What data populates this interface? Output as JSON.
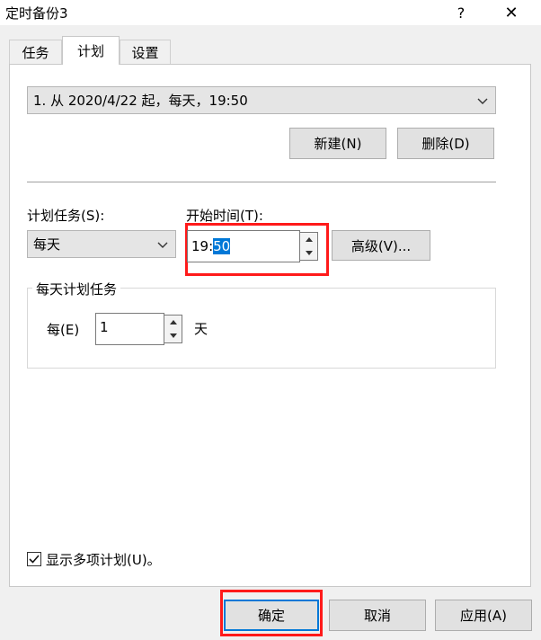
{
  "window": {
    "title": "定时备份3",
    "help_label": "?",
    "close_label": "✕"
  },
  "tabs": [
    {
      "label": "任务",
      "active": false
    },
    {
      "label": "计划",
      "active": true
    },
    {
      "label": "设置",
      "active": false
    }
  ],
  "schedule": {
    "selected": "1. 从 2020/4/22 起，每天，19:50",
    "new_label": "新建(N)",
    "delete_label": "删除(D)"
  },
  "schedule_task": {
    "label": "计划任务(S):",
    "value": "每天"
  },
  "start_time": {
    "label": "开始时间(T):",
    "hour_part": "19:",
    "minute_part": "50",
    "advanced_label": "高级(V)..."
  },
  "daily_group": {
    "title": "每天计划任务",
    "every_label": "每(E)",
    "every_value": "1",
    "unit": "天"
  },
  "show_multiple": {
    "label": "显示多项计划(U)。",
    "checked": true
  },
  "footer": {
    "ok_label": "确定",
    "cancel_label": "取消",
    "apply_label": "应用(A)"
  },
  "colors": {
    "highlight_border": "#ff1a1a",
    "selection": "#0078d7",
    "focus_button_border": "#0078d7"
  }
}
